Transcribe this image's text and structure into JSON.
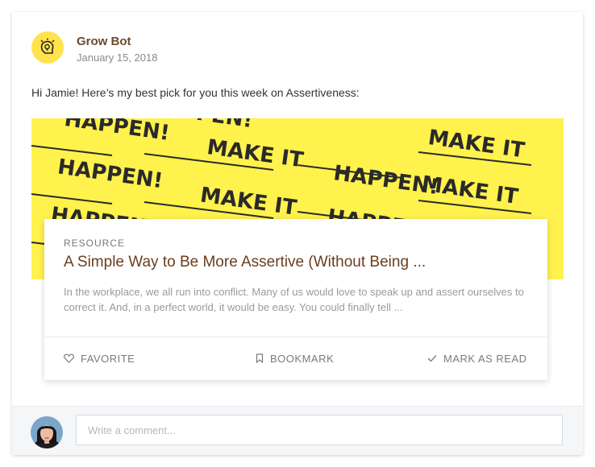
{
  "post": {
    "sender_name": "Grow Bot",
    "date": "January 15, 2018",
    "message": "Hi Jamie! Here’s my best pick for you this week on Assertiveness:"
  },
  "banner": {
    "text_make": "MAKE IT",
    "text_happen": "HAPPEN!",
    "background_color": "#fff24d"
  },
  "resource": {
    "tag": "RESOURCE",
    "title": "A Simple Way to Be More Assertive (Without Being ...",
    "description": "In the workplace, we all run into conflict. Many of us would love to speak up and assert ourselves to correct it. And, in a perfect world, it would be easy. You could finally tell ...",
    "actions": {
      "favorite": "FAVORITE",
      "bookmark": "BOOKMARK",
      "mark_read": "MARK AS READ"
    }
  },
  "comment": {
    "placeholder": "Write a comment..."
  },
  "colors": {
    "brand_yellow": "#ffe34d",
    "title_brown": "#6b3d1c",
    "name_brown": "#6b4a2c"
  },
  "icons": {
    "bot_avatar": "lightbulb-head-icon",
    "favorite": "heart-icon",
    "bookmark": "bookmark-icon",
    "mark_read": "check-icon"
  }
}
